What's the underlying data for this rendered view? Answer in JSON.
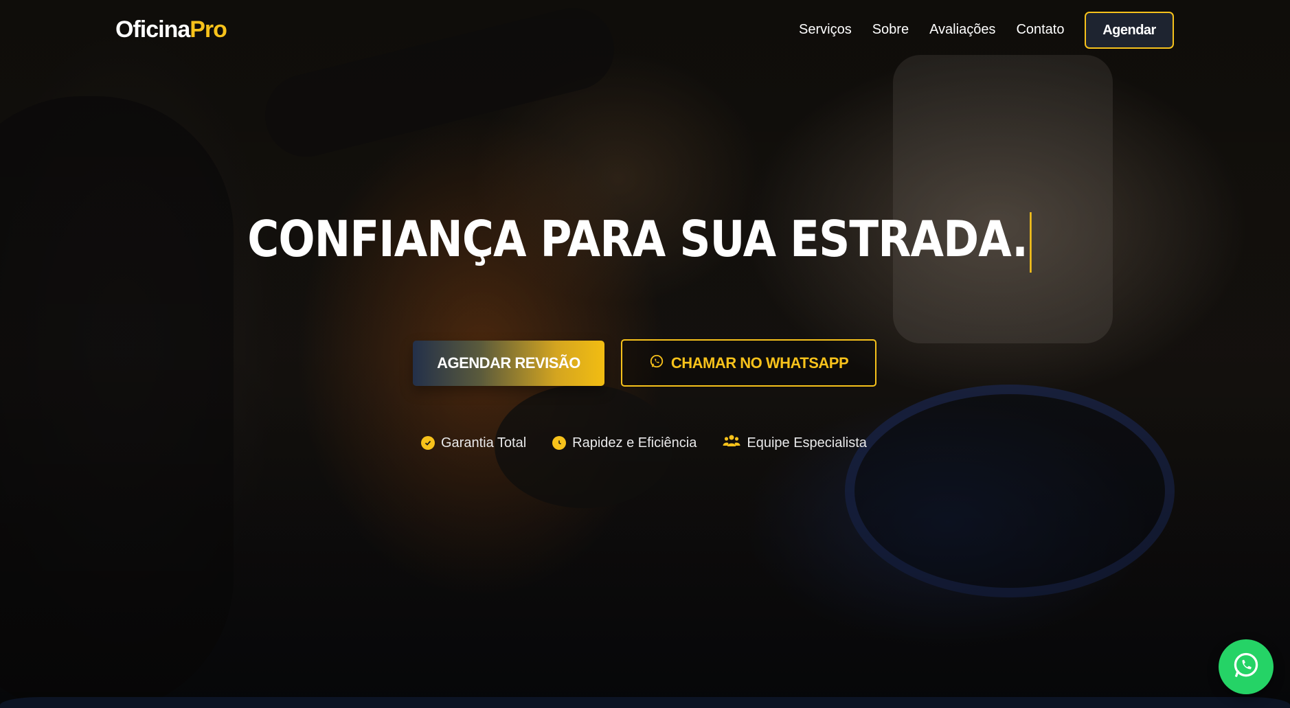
{
  "brand": {
    "name_part1": "Oficina",
    "name_part2": "Pro",
    "accent_color": "#f7c21b"
  },
  "nav": {
    "links": [
      {
        "label": "Serviços"
      },
      {
        "label": "Sobre"
      },
      {
        "label": "Avaliações"
      },
      {
        "label": "Contato"
      }
    ],
    "cta_label": "Agendar"
  },
  "hero": {
    "headline": "CONFIANÇA PARA SUA ESTRADA.",
    "primary_button": "AGENDAR REVISÃO",
    "secondary_button": "CHAMAR NO WHATSAPP",
    "secondary_button_icon": "whatsapp-icon",
    "features": [
      {
        "label": "Garantia Total",
        "icon": "check-circle-icon"
      },
      {
        "label": "Rapidez e Eficiência",
        "icon": "clock-icon"
      },
      {
        "label": "Equipe Especialista",
        "icon": "users-icon"
      }
    ]
  },
  "floating_button": {
    "icon": "whatsapp-icon",
    "color": "#25d366"
  }
}
